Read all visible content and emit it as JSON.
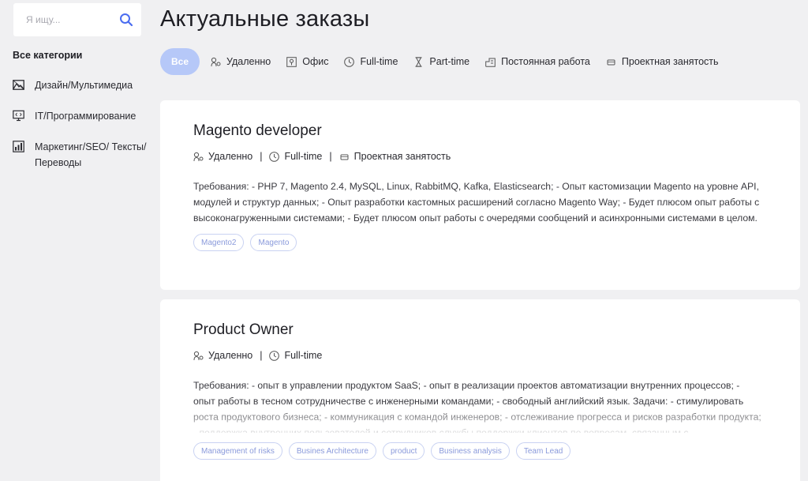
{
  "search": {
    "placeholder": "Я ищу...",
    "icon": "search-icon"
  },
  "sidebar": {
    "title": "Все категории",
    "items": [
      {
        "label": "Дизайн/Мультимедиа",
        "icon": "image-icon"
      },
      {
        "label": "IT/Программирование",
        "icon": "monitor-code-icon"
      },
      {
        "label": "Маркетинг/SEO/ Тексты/Переводы",
        "icon": "chart-icon"
      }
    ]
  },
  "page": {
    "title": "Актуальные заказы"
  },
  "filters": {
    "all": "Все",
    "items": [
      {
        "label": "Удаленно",
        "icon": "remote-icon"
      },
      {
        "label": "Офис",
        "icon": "office-icon"
      },
      {
        "label": "Full-time",
        "icon": "clock-icon"
      },
      {
        "label": "Part-time",
        "icon": "hourglass-icon"
      },
      {
        "label": "Постоянная работа",
        "icon": "building-icon"
      },
      {
        "label": "Проектная занятость",
        "icon": "briefcase-icon"
      }
    ]
  },
  "jobs": [
    {
      "title": "Magento developer",
      "meta": [
        "Удаленно",
        "Full-time",
        "Проектная занятость"
      ],
      "description": "Требования: - PHP 7, Magento 2.4, MySQL, Linux, RabbitMQ, Kafka, Elasticsearch; - Опыт кастомизации Magento на уровне API, модулей и структур данных; - Опыт разработки кастомных расширений согласно Magento Way; - Будет плюсом опыт работы с высоконагруженными системами; - Будет плюсом опыт работы с очередями сообщений и асинхронными системами в целом.",
      "tags": [
        "Magento2",
        "Magento"
      ]
    },
    {
      "title": "Product Owner",
      "meta": [
        "Удаленно",
        "Full-time"
      ],
      "description": "Требования: - опыт в управлении продуктом SaaS; - опыт в реализации проектов автоматизации внутренних процессов; - опыт работы в тесном сотрудничестве с инженерными командами; - свободный английский язык. Задачи: - стимулировать роста продуктового бизнеса; - коммуникация с командой инженеров; - отслеживание прогресса и рисков разработки продукта; - поддержка внутренних пользователей и сотрудников службы поддержки клиентов по вопросам, связанным с",
      "tags": [
        "Management of risks",
        "Busines Architecture",
        "product",
        "Business analysis",
        "Team Lead"
      ]
    }
  ],
  "colors": {
    "accent": "#b6c8f8",
    "tag_text": "#8a9adb",
    "background": "#f0f0f2",
    "search_icon": "#4a6cf0"
  }
}
